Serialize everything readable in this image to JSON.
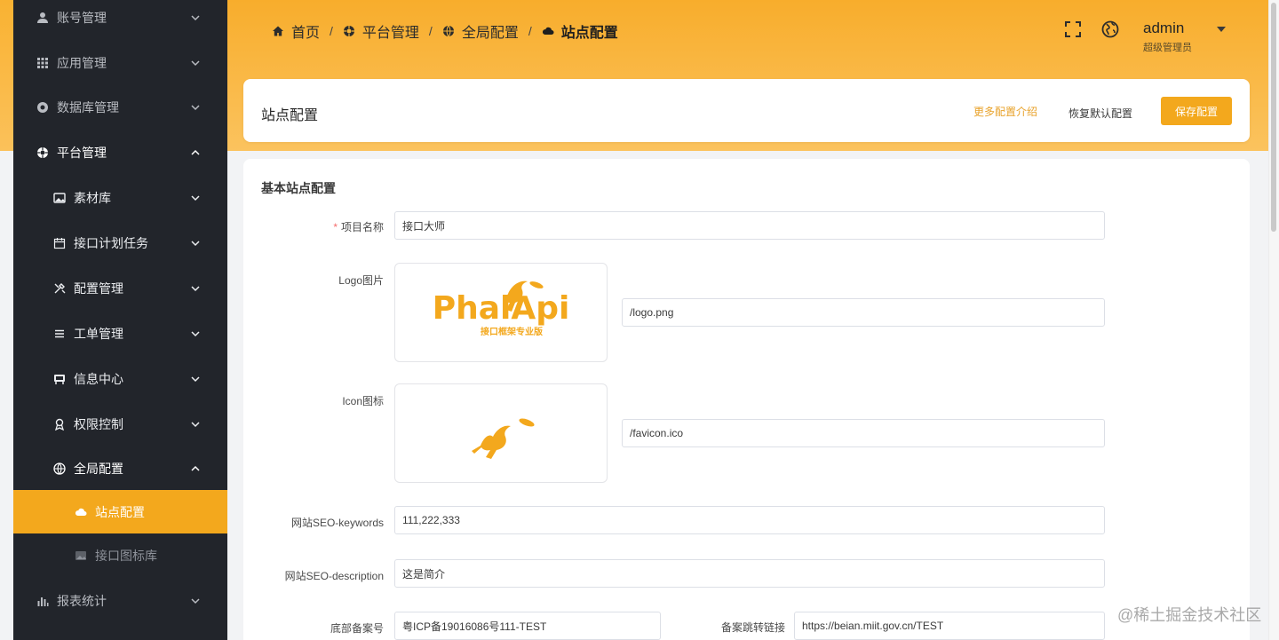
{
  "sidebar": {
    "items": [
      {
        "label": "账号管理",
        "icon": "user-icon",
        "chevron": "down"
      },
      {
        "label": "应用管理",
        "icon": "grid-icon",
        "chevron": "down"
      },
      {
        "label": "数据库管理",
        "icon": "database-icon",
        "chevron": "down"
      },
      {
        "label": "平台管理",
        "icon": "platform-icon",
        "chevron": "up"
      },
      {
        "label": "素材库",
        "icon": "image-icon",
        "chevron": "down"
      },
      {
        "label": "接口计划任务",
        "icon": "calendar-icon",
        "chevron": "down"
      },
      {
        "label": "配置管理",
        "icon": "tools-icon",
        "chevron": "down"
      },
      {
        "label": "工单管理",
        "icon": "list-icon",
        "chevron": "down"
      },
      {
        "label": "信息中心",
        "icon": "message-icon",
        "chevron": "down"
      },
      {
        "label": "权限控制",
        "icon": "permission-icon",
        "chevron": "down"
      },
      {
        "label": "全局配置",
        "icon": "globe-icon",
        "chevron": "up"
      },
      {
        "label": "站点配置",
        "icon": "cloud-icon"
      },
      {
        "label": "接口图标库",
        "icon": "gallery-icon"
      },
      {
        "label": "报表统计",
        "icon": "chart-icon",
        "chevron": "down"
      }
    ]
  },
  "breadcrumb": [
    "首页",
    "平台管理",
    "全局配置",
    "站点配置"
  ],
  "user": {
    "name": "admin",
    "role": "超级管理员"
  },
  "header": {
    "title": "站点配置",
    "more_link": "更多配置介绍",
    "reset_label": "恢复默认配置",
    "save_label": "保存配置"
  },
  "form": {
    "section_title": "基本站点配置",
    "project_name": {
      "label": "项目名称",
      "value": "接口大师"
    },
    "logo": {
      "label": "Logo图片",
      "value": "/logo.png",
      "logo_text": "PhalApi",
      "logo_tagline": "接口框架专业版"
    },
    "icon": {
      "label": "Icon图标",
      "value": "/favicon.ico"
    },
    "seo_keywords": {
      "label": "网站SEO-keywords",
      "value": "111,222,333"
    },
    "seo_description": {
      "label": "网站SEO-description",
      "value": "这是简介"
    },
    "icp": {
      "label": "底部备案号",
      "value": "粤ICP备19016086号111-TEST"
    },
    "icp_link": {
      "label": "备案跳转链接",
      "value": "https://beian.miit.gov.cn/TEST"
    }
  },
  "watermark": "@稀土掘金技术社区",
  "colors": {
    "accent": "#f3a81d",
    "sidebar_bg": "#22252b",
    "header_gradient_start": "#f8ad2c",
    "header_gradient_end": "#fbc35e"
  }
}
